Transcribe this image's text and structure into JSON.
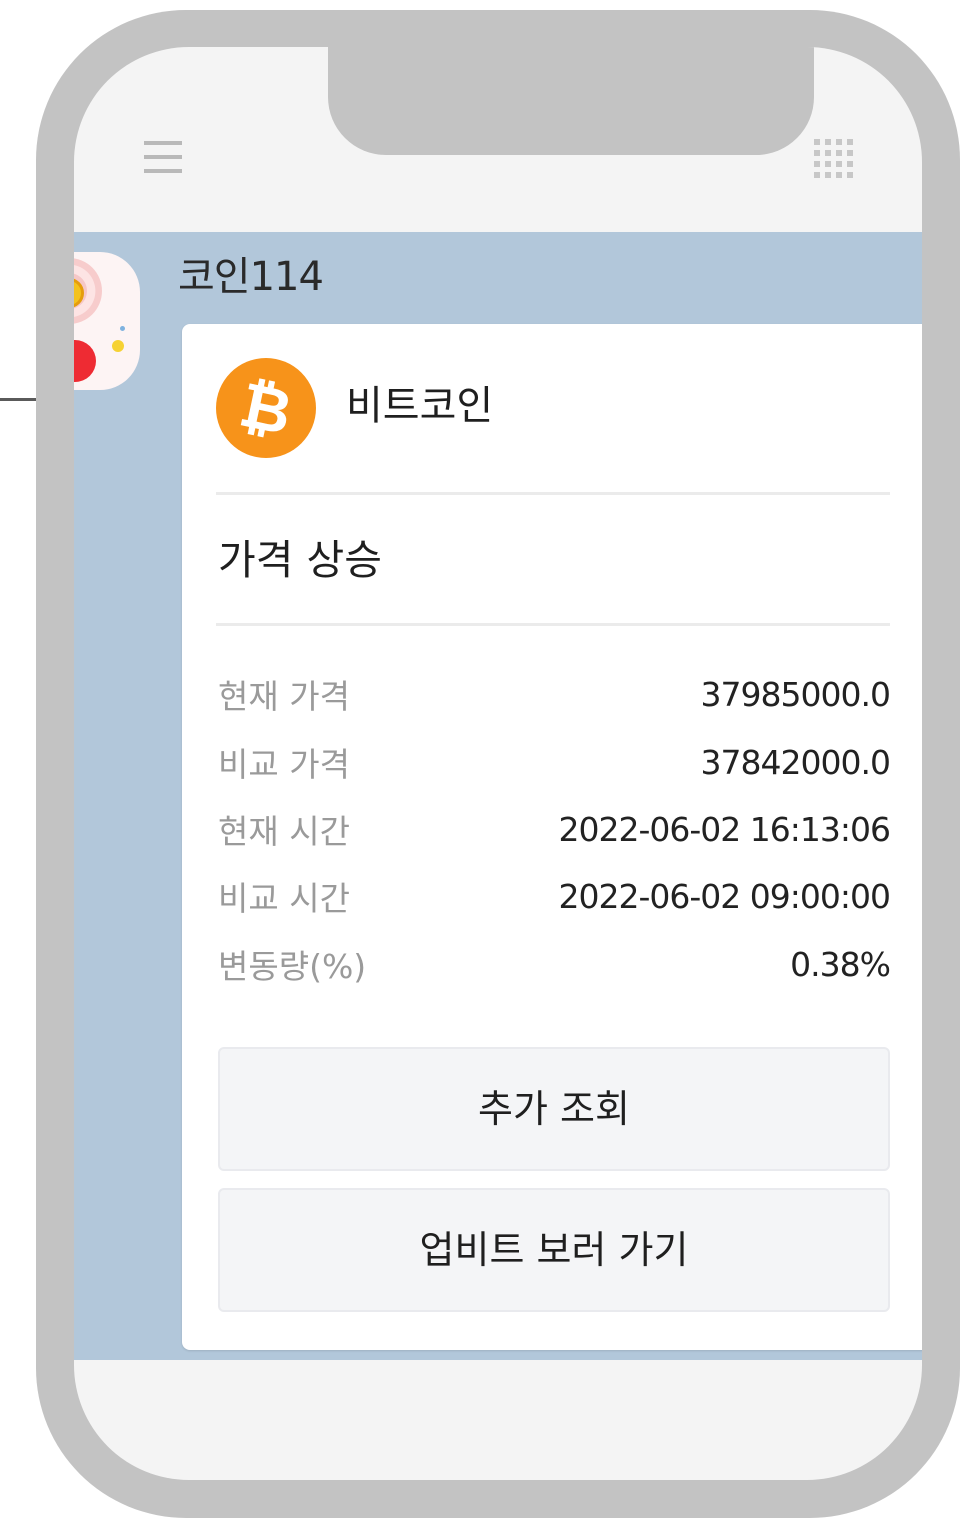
{
  "chat": {
    "bot_name": "코인114"
  },
  "card": {
    "coin_name": "비트코인",
    "coin_symbol": "₿",
    "status_title": "가격 상승",
    "rows": [
      {
        "label": "현재 가격",
        "value": "37985000.0"
      },
      {
        "label": "비교 가격",
        "value": "37842000.0"
      },
      {
        "label": "현재 시간",
        "value": "2022-06-02 16:13:06"
      },
      {
        "label": "비교 시간",
        "value": "2022-06-02 09:00:00"
      },
      {
        "label": "변동량(%)",
        "value": "0.38%"
      }
    ],
    "buttons": {
      "more_label": "추가 조회",
      "upbit_label": "업비트 보러 가기"
    }
  },
  "icons": {
    "menu": "hamburger-menu-icon",
    "apps": "apps-grid-icon",
    "coin_logo": "bitcoin-logo-icon",
    "avatar_coin": "dollar-coin-icon"
  },
  "colors": {
    "chat_background": "#b2c7da",
    "bitcoin_orange": "#f7931a",
    "phone_frame": "#c3c3c3"
  }
}
